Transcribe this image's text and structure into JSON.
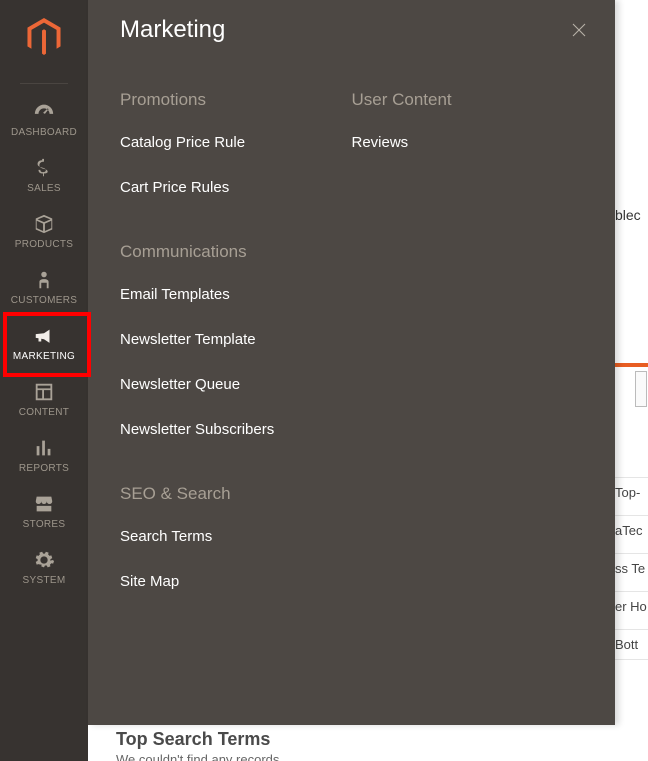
{
  "sidebar": {
    "items": [
      {
        "label": "DASHBOARD"
      },
      {
        "label": "SALES"
      },
      {
        "label": "PRODUCTS"
      },
      {
        "label": "CUSTOMERS"
      },
      {
        "label": "MARKETING"
      },
      {
        "label": "CONTENT"
      },
      {
        "label": "REPORTS"
      },
      {
        "label": "STORES"
      },
      {
        "label": "SYSTEM"
      }
    ]
  },
  "flyout": {
    "title": "Marketing",
    "sections": {
      "promotions": {
        "title": "Promotions",
        "links": [
          "Catalog Price Rule",
          "Cart Price Rules"
        ]
      },
      "user_content": {
        "title": "User Content",
        "links": [
          "Reviews"
        ]
      },
      "communications": {
        "title": "Communications",
        "links": [
          "Email Templates",
          "Newsletter Template",
          "Newsletter Queue",
          "Newsletter Subscribers"
        ]
      },
      "seo_search": {
        "title": "SEO & Search",
        "links": [
          "Search Terms",
          "Site Map"
        ]
      }
    }
  },
  "background": {
    "partial_text_1": "blec",
    "row_texts": [
      "Top-",
      "aTec",
      "ss Te",
      "er Ho",
      "Bott"
    ]
  },
  "bottom": {
    "title": "Top Search Terms",
    "subtitle": "We couldn't find any records."
  }
}
